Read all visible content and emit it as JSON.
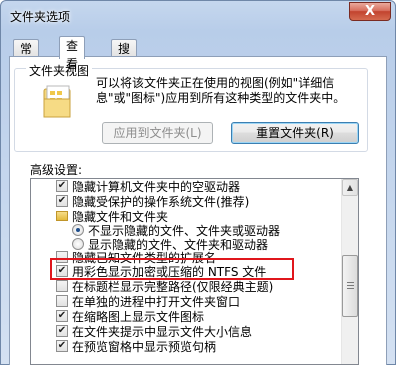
{
  "window": {
    "title": "文件夹选项",
    "close_label": "X"
  },
  "tabs": [
    {
      "label": "常规"
    },
    {
      "label": "查看",
      "active": true
    },
    {
      "label": "搜索"
    }
  ],
  "folder_views": {
    "group_title": "文件夹视图",
    "description": "可以将该文件夹正在使用的视图(例如\"详细信息\"或\"图标\")应用到所有这种类型的文件夹中。",
    "apply_button": "应用到文件夹(L)",
    "reset_button": "重置文件夹(R)"
  },
  "advanced": {
    "label": "高级设置:",
    "items": [
      {
        "type": "checkbox",
        "checked": true,
        "label": "隐藏计算机文件夹中的空驱动器"
      },
      {
        "type": "checkbox",
        "checked": true,
        "label": "隐藏受保护的操作系统文件(推荐)"
      },
      {
        "type": "folder",
        "label": "隐藏文件和文件夹"
      },
      {
        "type": "radio",
        "checked": true,
        "label": "不显示隐藏的文件、文件夹或驱动器"
      },
      {
        "type": "radio",
        "checked": false,
        "label": "显示隐藏的文件、文件夹和驱动器"
      },
      {
        "type": "checkbox",
        "checked": false,
        "label": "隐藏已知文件类型的扩展名"
      },
      {
        "type": "checkbox",
        "checked": true,
        "label": "用彩色显示加密或压缩的 NTFS 文件"
      },
      {
        "type": "checkbox",
        "checked": false,
        "label": "在标题栏显示完整路径(仅限经典主题)"
      },
      {
        "type": "checkbox",
        "checked": false,
        "label": "在单独的进程中打开文件夹窗口"
      },
      {
        "type": "checkbox",
        "checked": true,
        "label": "在缩略图上显示文件图标"
      },
      {
        "type": "checkbox",
        "checked": true,
        "label": "在文件夹提示中显示文件大小信息"
      },
      {
        "type": "checkbox",
        "checked": true,
        "label": "在预览窗格中显示预览句柄"
      }
    ]
  },
  "colors": {
    "highlight": "#e0161c",
    "frame": "#b8cde9"
  }
}
